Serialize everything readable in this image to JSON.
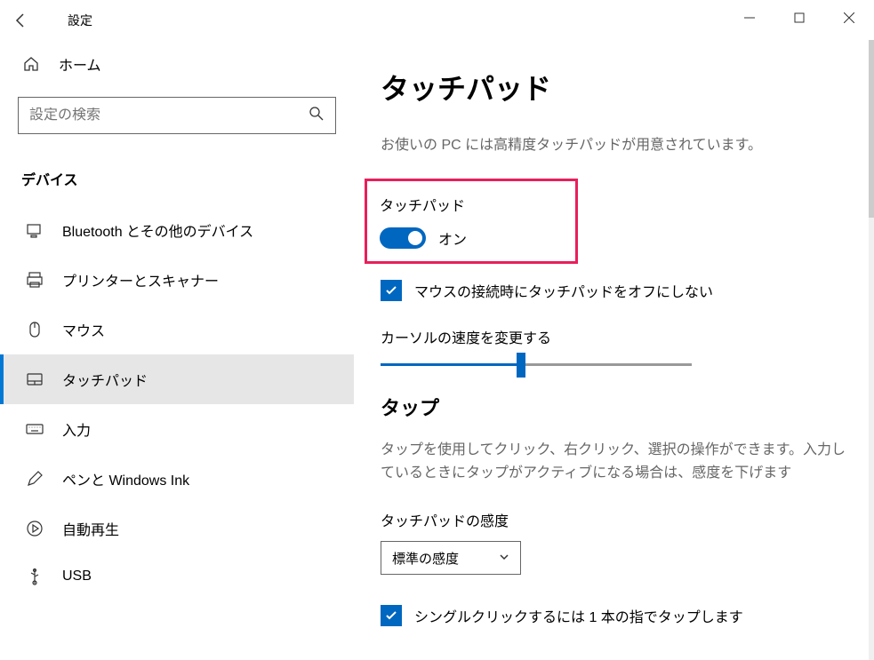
{
  "window": {
    "title": "設定"
  },
  "sidebar": {
    "home_label": "ホーム",
    "search_placeholder": "設定の検索",
    "category": "デバイス",
    "items": [
      {
        "label": "Bluetooth とその他のデバイス",
        "selected": false
      },
      {
        "label": "プリンターとスキャナー",
        "selected": false
      },
      {
        "label": "マウス",
        "selected": false
      },
      {
        "label": "タッチパッド",
        "selected": true
      },
      {
        "label": "入力",
        "selected": false
      },
      {
        "label": "ペンと Windows Ink",
        "selected": false
      },
      {
        "label": "自動再生",
        "selected": false
      },
      {
        "label": "USB",
        "selected": false
      }
    ]
  },
  "main": {
    "title": "タッチパッド",
    "description": "お使いの PC には高精度タッチパッドが用意されています。",
    "touchpad_section_label": "タッチパッド",
    "toggle_state": "オン",
    "checkbox_mouse_label": "マウスの接続時にタッチパッドをオフにしない",
    "cursor_speed_label": "カーソルの速度を変更する",
    "cursor_speed_value": 45,
    "tap_heading": "タップ",
    "tap_description": "タップを使用してクリック、右クリック、選択の操作ができます。入力しているときにタップがアクティブになる場合は、感度を下げます",
    "sensitivity_label": "タッチパッドの感度",
    "sensitivity_value": "標準の感度",
    "single_tap_label": "シングルクリックするには 1 本の指でタップします"
  }
}
